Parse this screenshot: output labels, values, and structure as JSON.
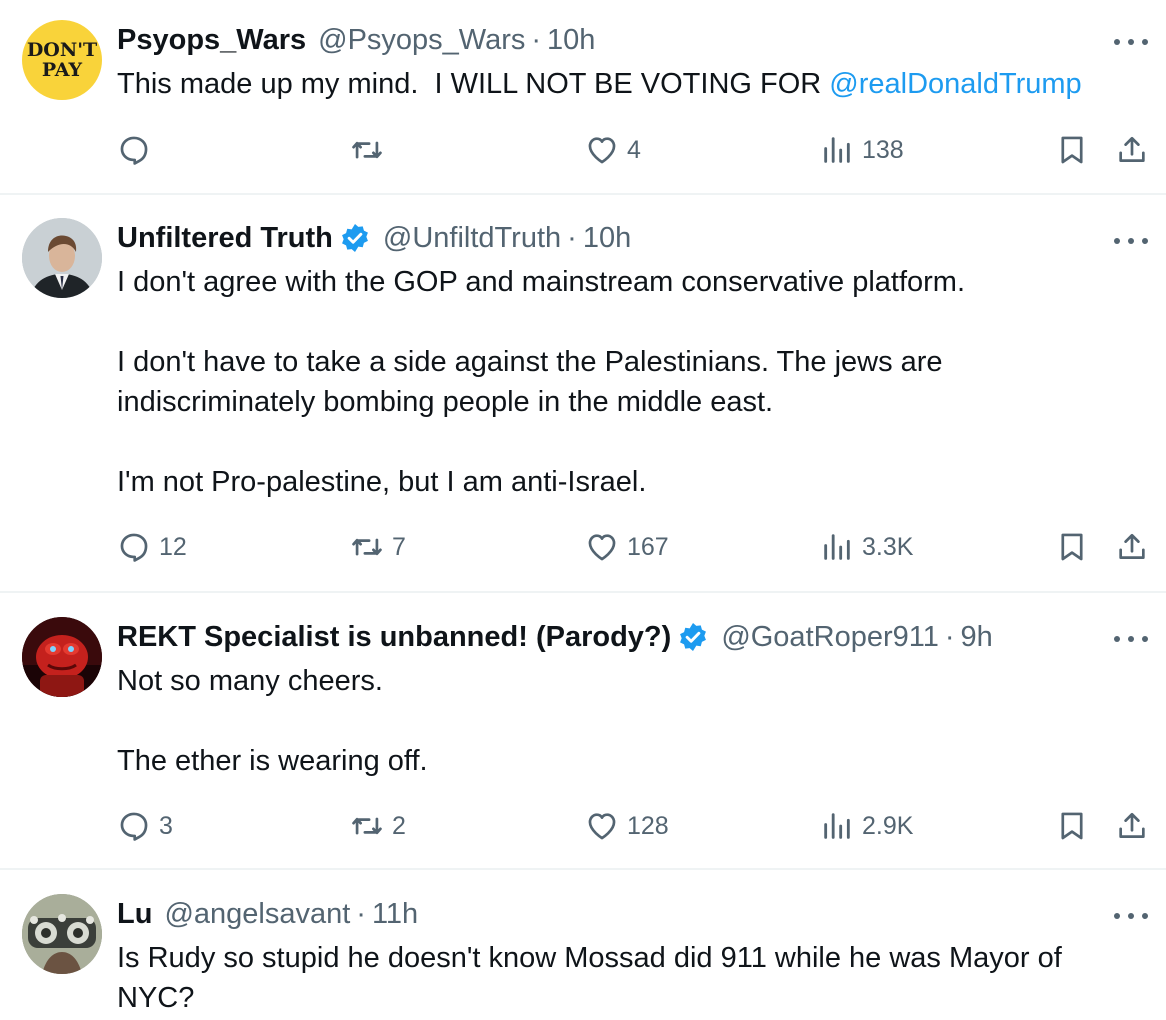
{
  "colors": {
    "text": "#0f1419",
    "secondary": "#536471",
    "link": "#1d9bf0",
    "divider": "#eff3f4",
    "verified": "#1d9bf0"
  },
  "tweets": [
    {
      "name": "Psyops_Wars",
      "verified": false,
      "handle": "@Psyops_Wars",
      "dot": "·",
      "time": "10h",
      "avatar": {
        "type": "logo",
        "lines": [
          "DON'T",
          "PAY"
        ]
      },
      "text_before": "This made up my mind.  I WILL NOT BE VOTING FOR ",
      "mention": "@realDonaldTrump",
      "paragraphs": [],
      "stats": {
        "replies": "",
        "reposts": "",
        "likes": "4",
        "views": "138"
      }
    },
    {
      "name": "Unfiltered Truth",
      "verified": true,
      "handle": "@UnfiltdTruth",
      "dot": "·",
      "time": "10h",
      "avatar": {
        "type": "photo-portrait"
      },
      "paragraphs": [
        "I don't agree with the GOP and mainstream conservative platform.",
        "I don't have to take a side against the Palestinians. The jews are indiscriminately bombing people in the middle east.",
        "I'm not Pro-palestine, but I am anti-Israel."
      ],
      "stats": {
        "replies": "12",
        "reposts": "7",
        "likes": "167",
        "views": "3.3K"
      }
    },
    {
      "name": "REKT Specialist is unbanned! (Parody?)",
      "verified": true,
      "handle": "@GoatRoper911",
      "dot": "·",
      "time": "9h",
      "avatar": {
        "type": "photo-red-frog"
      },
      "paragraphs": [
        "Not so many cheers.",
        "The ether is wearing off."
      ],
      "stats": {
        "replies": "3",
        "reposts": "2",
        "likes": "128",
        "views": "2.9K"
      }
    },
    {
      "name": "Lu",
      "verified": false,
      "handle": "@angelsavant",
      "dot": "·",
      "time": "11h",
      "avatar": {
        "type": "photo-phoropter"
      },
      "paragraphs": [
        "Is Rudy so stupid he doesn't know Mossad did 911 while he was Mayor of NYC?"
      ],
      "stats": null
    }
  ]
}
